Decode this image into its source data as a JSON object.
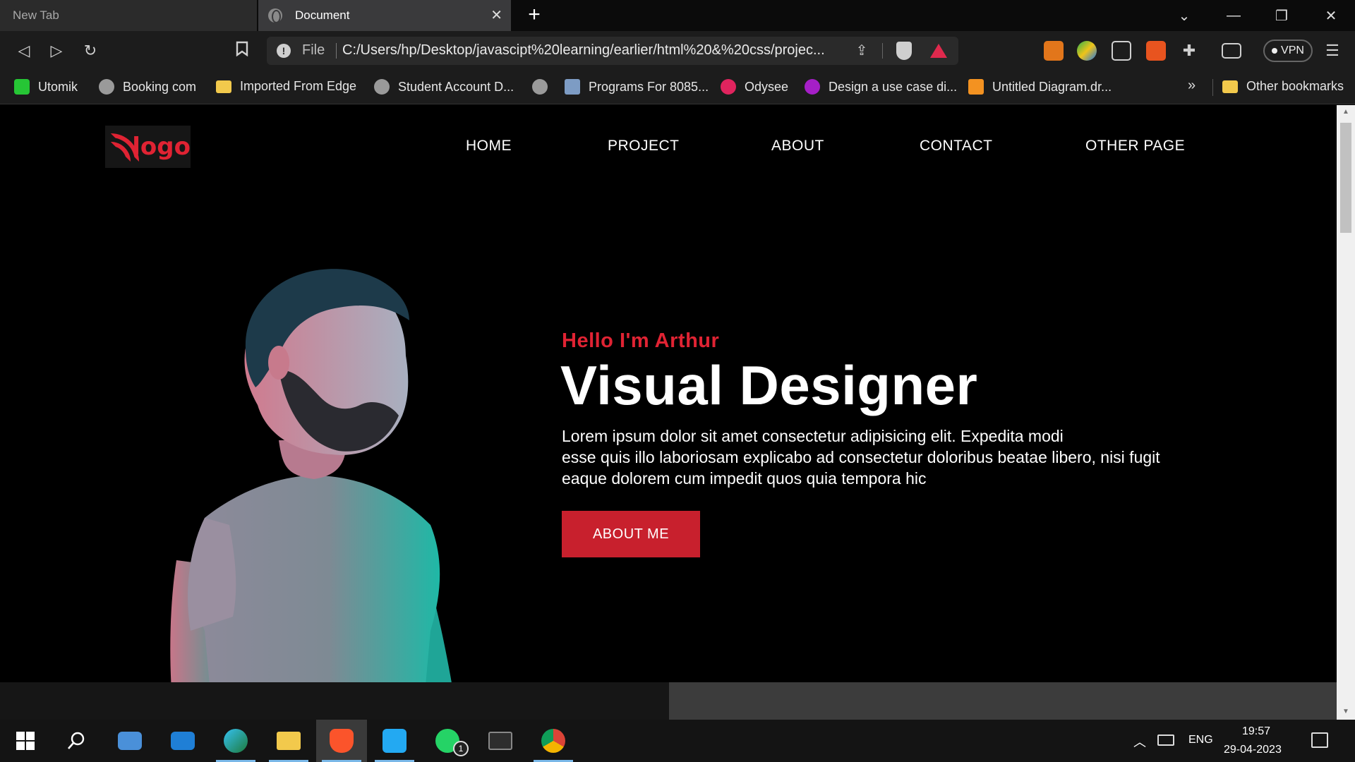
{
  "browser": {
    "tabs": [
      {
        "title": "New Tab"
      },
      {
        "title": "Document"
      }
    ],
    "omnibox": {
      "scheme_label": "File",
      "url": "C:/Users/hp/Desktop/javascipt%20learning/earlier/html%20&%20css/projec..."
    },
    "vpn_label": "VPN",
    "bookmarks": [
      {
        "label": "Utomik",
        "icon": "utomik-icon"
      },
      {
        "label": "Booking com",
        "icon": "globe-icon"
      },
      {
        "label": "Imported From Edge",
        "icon": "folder-icon"
      },
      {
        "label": "Student Account D...",
        "icon": "globe-icon"
      },
      {
        "label": "",
        "icon": "globe-icon"
      },
      {
        "label": "Programs For 8085...",
        "icon": "chip-icon"
      },
      {
        "label": "Odysee",
        "icon": "odysee-icon"
      },
      {
        "label": "Design a use case di...",
        "icon": "swift-icon"
      },
      {
        "label": "Untitled Diagram.dr...",
        "icon": "drawio-icon"
      }
    ],
    "more_bookmarks": "»",
    "other_bookmarks": "Other bookmarks"
  },
  "site": {
    "logo_text": "logo",
    "nav": [
      "HOME",
      "PROJECT",
      "ABOUT",
      "CONTACT",
      "OTHER PAGE"
    ],
    "hero": {
      "greeting": "Hello I'm Arthur",
      "headline": "Visual Designer",
      "paragraph_lines": [
        "Lorem ipsum dolor sit amet consectetur adipisicing elit. Expedita modi",
        "esse quis illo laboriosam explicabo ad consectetur doloribus beatae libero, nisi fugit",
        "eaque dolorem cum impedit quos quia tempora hic"
      ],
      "button": "ABOUT ME"
    },
    "colors": {
      "accent": "#e02333",
      "button": "#c8202d",
      "background": "#000000"
    }
  },
  "taskbar": {
    "apps": [
      "start",
      "search",
      "this-pc",
      "mail",
      "edge",
      "file-explorer",
      "brave",
      "vscode",
      "whatsapp",
      "terminal",
      "chrome"
    ],
    "whatsapp_badge": "1",
    "language": "ENG",
    "time": "19:57",
    "date": "29-04-2023"
  }
}
